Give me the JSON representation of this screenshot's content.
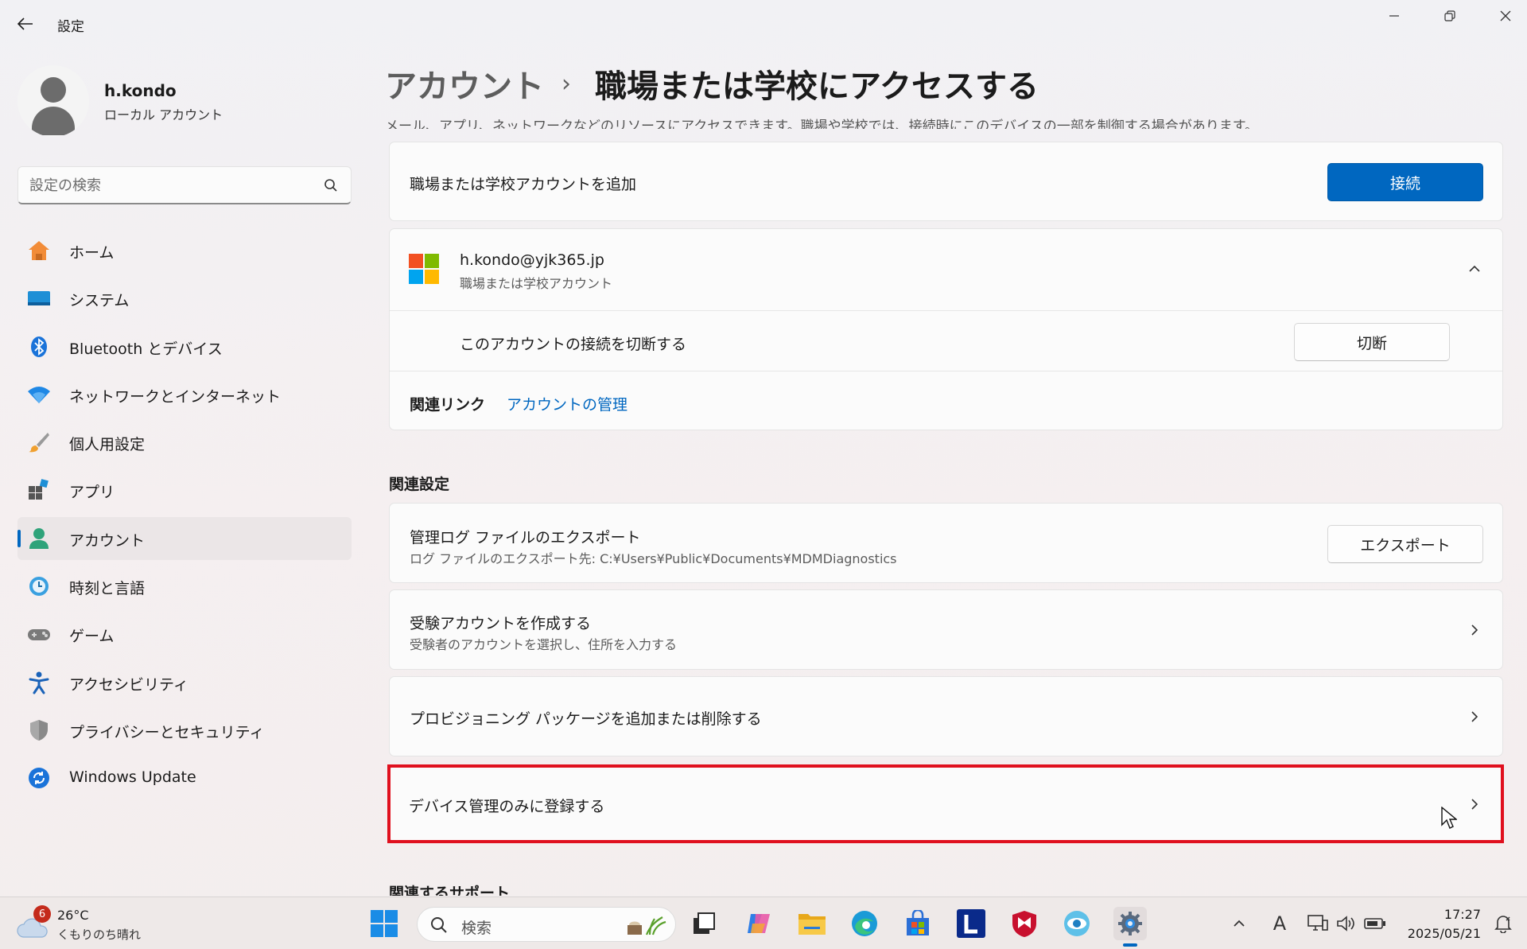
{
  "window": {
    "title": "設定",
    "controls": [
      "minimize-icon",
      "maximize-icon",
      "close-icon"
    ]
  },
  "profile": {
    "name": "h.kondo",
    "account_type": "ローカル アカウント"
  },
  "search": {
    "placeholder": "設定の検索"
  },
  "sidebar": {
    "items": [
      {
        "label": "ホーム",
        "icon": "home-icon"
      },
      {
        "label": "システム",
        "icon": "system-icon"
      },
      {
        "label": "Bluetooth とデバイス",
        "icon": "bluetooth-icon"
      },
      {
        "label": "ネットワークとインターネット",
        "icon": "wifi-icon"
      },
      {
        "label": "個人用設定",
        "icon": "brush-icon"
      },
      {
        "label": "アプリ",
        "icon": "apps-icon"
      },
      {
        "label": "アカウント",
        "icon": "account-icon",
        "selected": true
      },
      {
        "label": "時刻と言語",
        "icon": "time-language-icon"
      },
      {
        "label": "ゲーム",
        "icon": "gamepad-icon"
      },
      {
        "label": "アクセシビリティ",
        "icon": "accessibility-icon"
      },
      {
        "label": "プライバシーとセキュリティ",
        "icon": "shield-icon"
      },
      {
        "label": "Windows Update",
        "icon": "update-icon"
      }
    ]
  },
  "breadcrumb": {
    "parent": "アカウント",
    "separator": "›",
    "current": "職場または学校にアクセスする"
  },
  "intro_cut": "メール、アプリ、ネットワークなどのリソースにアクセスできます。職場や学校では、接続時にこのデバイスの一部を制御する場合があります。",
  "add_account": {
    "label": "職場または学校アカウントを追加",
    "button": "接続"
  },
  "account_entry": {
    "email": "h.kondo@yjk365.jp",
    "type": "職場または学校アカウント",
    "disconnect_label": "このアカウントの接続を切断する",
    "disconnect_button": "切断",
    "related_links_label": "関連リンク",
    "manage_link": "アカウントの管理"
  },
  "related_settings": {
    "title": "関連設定",
    "export": {
      "title": "管理ログ ファイルのエクスポート",
      "subtitle": "ログ ファイルのエクスポート先: C:¥Users¥Public¥Documents¥MDMDiagnostics",
      "button": "エクスポート"
    },
    "exam": {
      "title": "受験アカウントを作成する",
      "subtitle": "受験者のアカウントを選択し、住所を入力する"
    },
    "provisioning": {
      "title": "プロビジョニング パッケージを追加または削除する"
    },
    "enroll": {
      "title": "デバイス管理のみに登録する"
    }
  },
  "related_support_cut": "関連するサポート",
  "colors": {
    "accent": "#0067c0",
    "highlight_border": "#e0101e"
  },
  "taskbar": {
    "weather_temp": "26°C",
    "weather_desc": "くもりのち晴れ",
    "weather_badge": "6",
    "search_placeholder": "検索",
    "ime": "A",
    "time": "17:27",
    "date": "2025/05/21",
    "apps": [
      "start-icon",
      "search-icon",
      "task-view-icon",
      "copilot-icon",
      "file-explorer-icon",
      "edge-icon",
      "store-icon",
      "l-app-icon",
      "mcafee-icon",
      "browser-app-icon",
      "settings-icon"
    ]
  }
}
